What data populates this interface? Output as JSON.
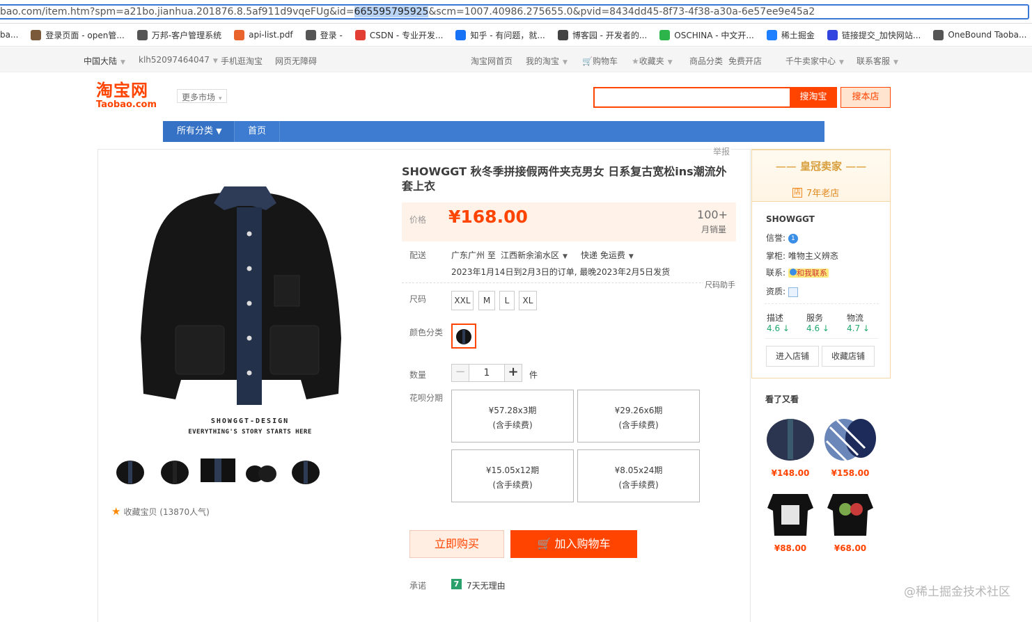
{
  "browser": {
    "url_before": "bao.com/item.htm?spm=a21bo.jianhua.201876.8.5af911d9vqeFUg&id=",
    "url_selected": "665595795925",
    "url_after": "&scm=1007.40986.275655.0&pvid=8434dd45-8f73-4f38-a30a-6e57ee9e45a2",
    "bookmarks": [
      {
        "label": "ba...",
        "icon": "folder-icon",
        "color": "#888888"
      },
      {
        "label": "登录页面 - open管...",
        "icon": "page-icon",
        "color": "#7a5a3a"
      },
      {
        "label": "万邦-客户管理系统",
        "icon": "globe-icon",
        "color": "#555555"
      },
      {
        "label": "api-list.pdf",
        "icon": "pdf-icon",
        "color": "#e8642c"
      },
      {
        "label": "登录 -",
        "icon": "globe-icon",
        "color": "#555555"
      },
      {
        "label": "CSDN - 专业开发...",
        "icon": "csdn-icon",
        "color": "#e33e33"
      },
      {
        "label": "知乎 - 有问题，就...",
        "icon": "zhihu-icon",
        "color": "#1772f6"
      },
      {
        "label": "博客园 - 开发者的...",
        "icon": "cnblogs-icon",
        "color": "#444444"
      },
      {
        "label": "OSCHINA - 中文开...",
        "icon": "oschina-icon",
        "color": "#2db44a"
      },
      {
        "label": "稀土掘金",
        "icon": "juejin-icon",
        "color": "#1e80ff"
      },
      {
        "label": "链接提交_加快网站...",
        "icon": "baidu-icon",
        "color": "#3245df"
      },
      {
        "label": "OneBound Taoba...",
        "icon": "globe-icon",
        "color": "#555555"
      }
    ]
  },
  "site_nav": {
    "region": "中国大陆",
    "user": "klh52097464047",
    "mobile": "手机逛淘宝",
    "accessible": "网页无障碍",
    "home": "淘宝网首页",
    "my_taobao": "我的淘宝",
    "cart": "购物车",
    "favorites": "收藏夹",
    "categories": "商品分类",
    "free_shop": "免费开店",
    "seller_center": "千牛卖家中心",
    "service": "联系客服"
  },
  "header": {
    "logo_cn": "淘宝网",
    "logo_en": "Taobao.com",
    "more_market": "更多市场",
    "search_button": "搜淘宝",
    "shop_search_button": "搜本店"
  },
  "bluenav": {
    "all_categories": "所有分类",
    "home": "首页"
  },
  "product": {
    "report": "举报",
    "title": "SHOWGGT 秋冬季拼接假两件夹克男女 日系复古宽松ins潮流外套上衣",
    "brand_line": "SHOWGGT-DESIGN",
    "slogan": "EVERYTHING'S STORY STARTS HERE",
    "price_label": "价格",
    "price": "¥168.00",
    "sales_count": "100+",
    "sales_label": "月销量",
    "delivery_label": "配送",
    "delivery_from": "广东广州 至",
    "delivery_to": "江西新余渝水区",
    "shipping": "快递 免运费",
    "delivery_note": "2023年1月14日到2月3日的订单, 最晚2023年2月5日发货",
    "size_helper": "尺码助手",
    "size_label": "尺码",
    "sizes": [
      "XXL",
      "M",
      "L",
      "XL"
    ],
    "color_label": "颜色分类",
    "qty_label": "数量",
    "qty_value": "1",
    "qty_unit": "件",
    "installment_label": "花呗分期",
    "installments": [
      {
        "amount": "¥57.28x3期",
        "fee": "(含手续费)"
      },
      {
        "amount": "¥29.26x6期",
        "fee": "(含手续费)"
      },
      {
        "amount": "¥15.05x12期",
        "fee": "(含手续费)"
      },
      {
        "amount": "¥8.05x24期",
        "fee": "(含手续费)"
      }
    ],
    "buy_now": "立即购买",
    "add_to_cart": "加入购物车",
    "promise_label": "承诺",
    "promise_icon_text": "7",
    "promise_text": "7天无理由",
    "favorite": "收藏宝贝 (13870人气)"
  },
  "seller": {
    "crown": "皇冠卖家",
    "old_shop": "7年老店",
    "old_shop_icon": "店",
    "name": "SHOWGGT",
    "credit_label": "信誉:",
    "keeper_label": "掌柜:",
    "keeper": "唯物主义辨忞",
    "contact_label": "联系:",
    "contact_button": "和我联系",
    "qualification_label": "资质:",
    "scores": [
      {
        "label": "描述",
        "value": "4.6"
      },
      {
        "label": "服务",
        "value": "4.6"
      },
      {
        "label": "物流",
        "value": "4.7"
      }
    ],
    "enter_shop": "进入店铺",
    "fav_shop": "收藏店铺"
  },
  "also_viewed": {
    "title": "看了又看",
    "items": [
      {
        "price": "¥148.00"
      },
      {
        "price": "¥158.00"
      },
      {
        "price": "¥88.00"
      },
      {
        "price": "¥68.00"
      }
    ]
  },
  "watermark": "@稀土掘金技术社区",
  "colors": {
    "accent": "#ff4400",
    "nav_blue": "#3e7cd1",
    "score_green": "#1faa6f"
  }
}
